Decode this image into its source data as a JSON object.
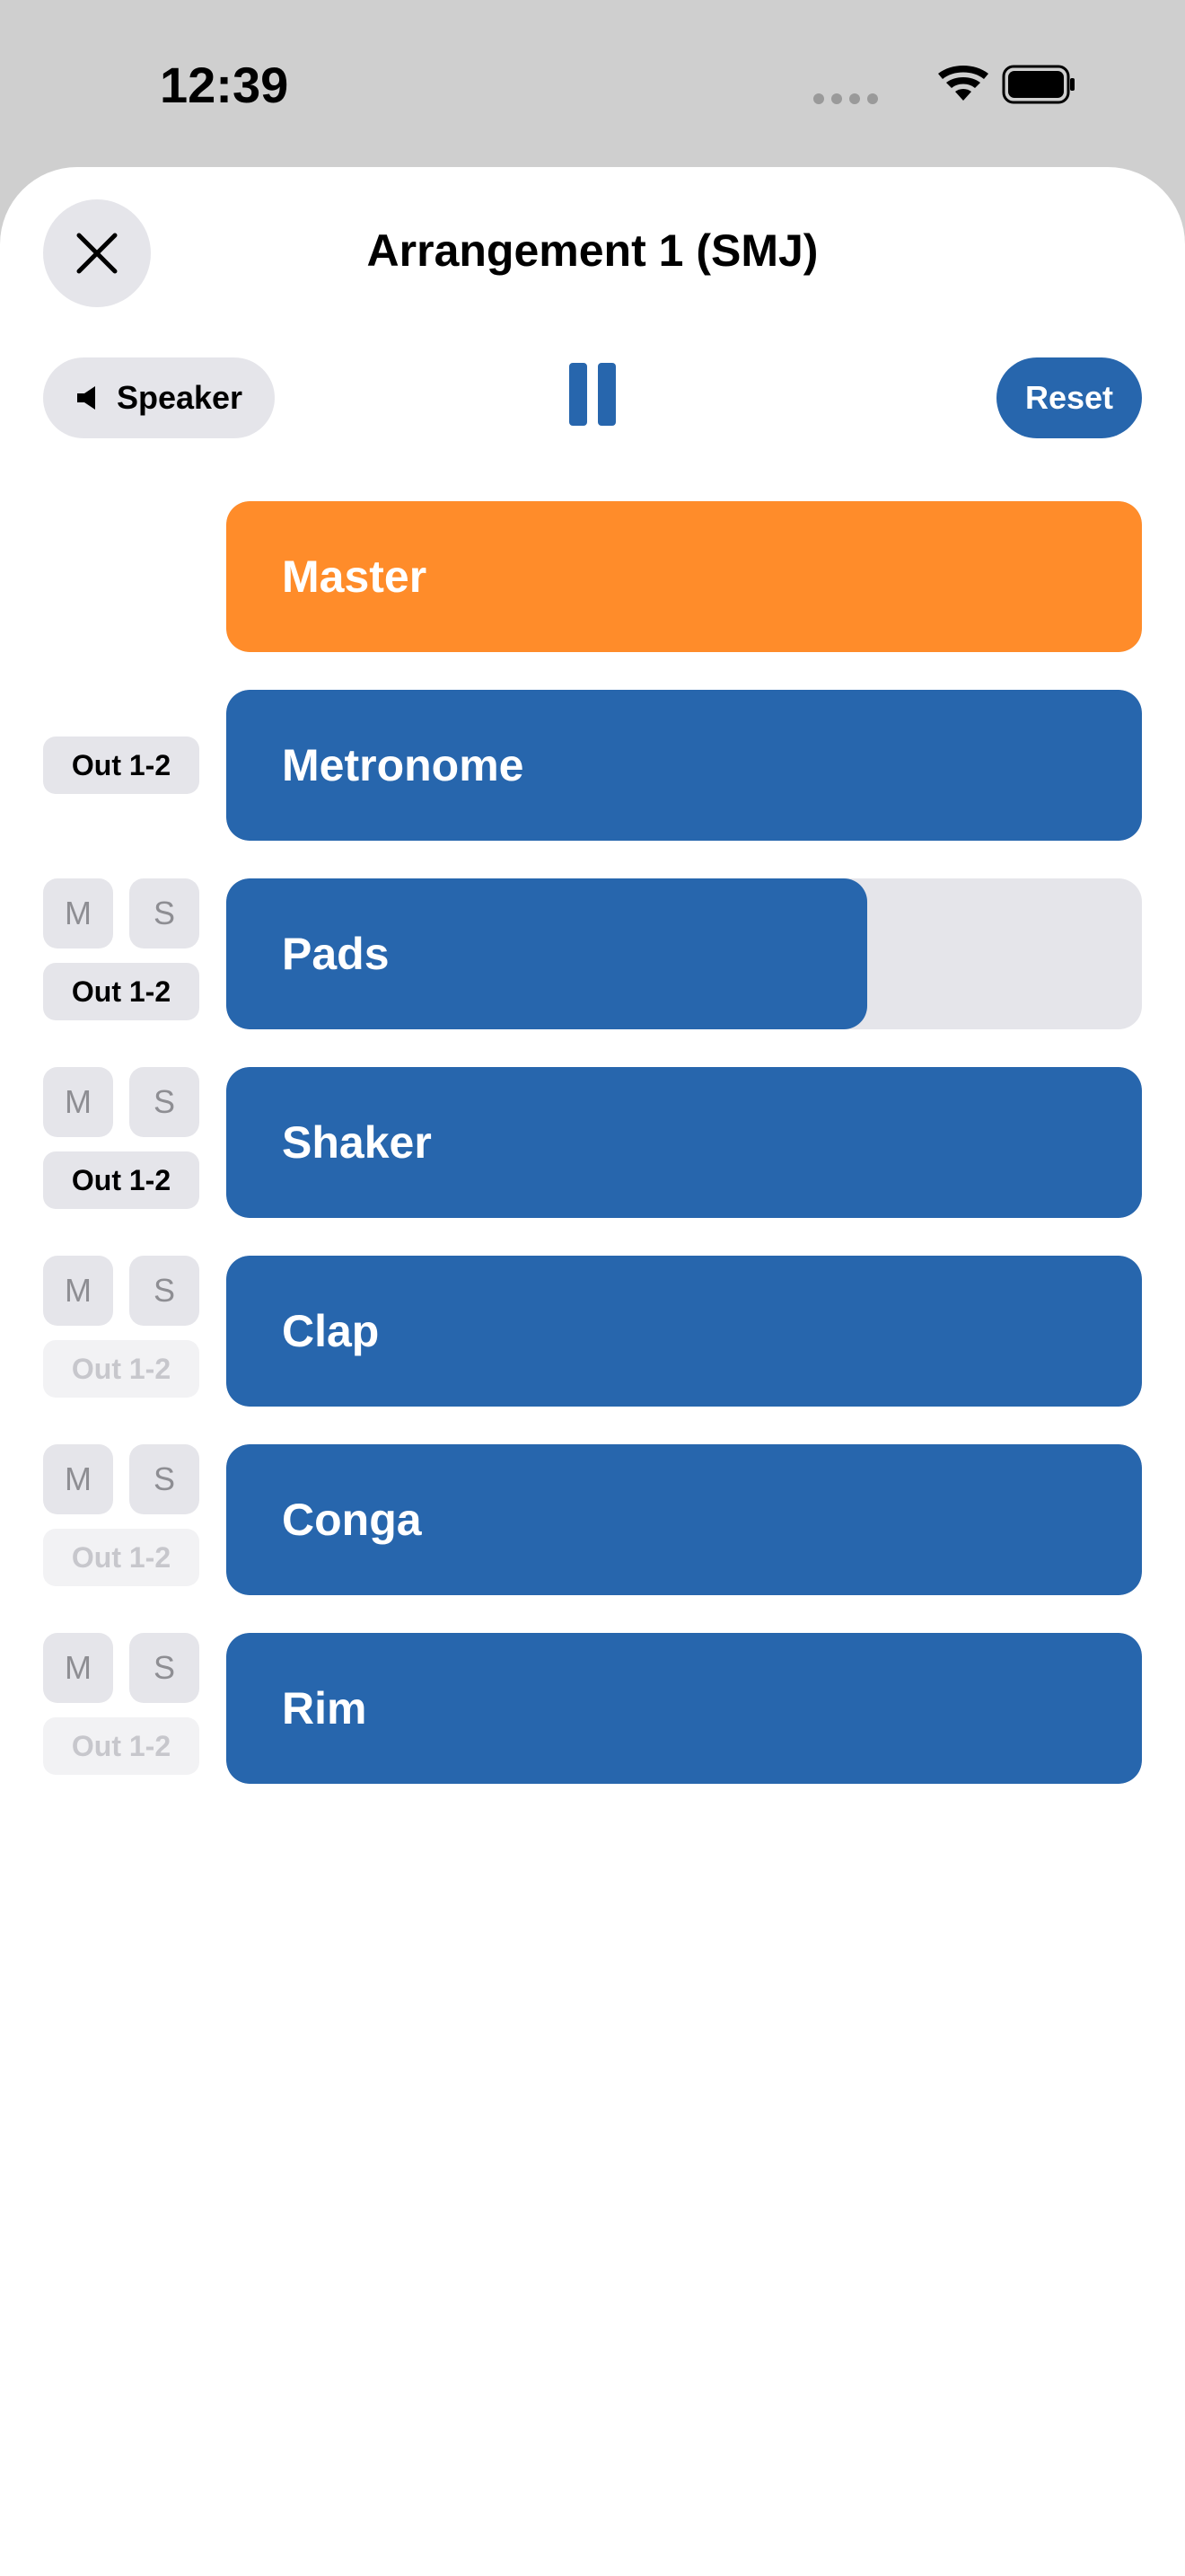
{
  "status_bar": {
    "time": "12:39"
  },
  "sheet": {
    "title": "Arrangement 1 (SMJ)",
    "close_icon": "close-icon"
  },
  "toolbar": {
    "speaker_label": "Speaker",
    "speaker_icon": "speaker-icon",
    "pause_icon": "pause-icon",
    "reset_label": "Reset"
  },
  "colors": {
    "accent": "#2766ad",
    "master": "#ff8c2a",
    "track_bg": "#e5e5ea"
  },
  "tracks": [
    {
      "name": "Master",
      "level": 1.0,
      "out": ""
    },
    {
      "name": "Metronome",
      "level": 1.0,
      "out": "Out 1-2",
      "out_enabled": true
    },
    {
      "name": "Pads",
      "level": 0.7,
      "mute": "M",
      "solo": "S",
      "out": "Out 1-2",
      "out_enabled": true
    },
    {
      "name": "Shaker",
      "level": 1.0,
      "mute": "M",
      "solo": "S",
      "out": "Out 1-2",
      "out_enabled": true
    },
    {
      "name": "Clap",
      "level": 1.0,
      "mute": "M",
      "solo": "S",
      "out": "Out 1-2",
      "out_enabled": false
    },
    {
      "name": "Conga",
      "level": 1.0,
      "mute": "M",
      "solo": "S",
      "out": "Out 1-2",
      "out_enabled": false
    },
    {
      "name": "Rim",
      "level": 1.0,
      "mute": "M",
      "solo": "S",
      "out": "Out 1-2",
      "out_enabled": false
    }
  ]
}
